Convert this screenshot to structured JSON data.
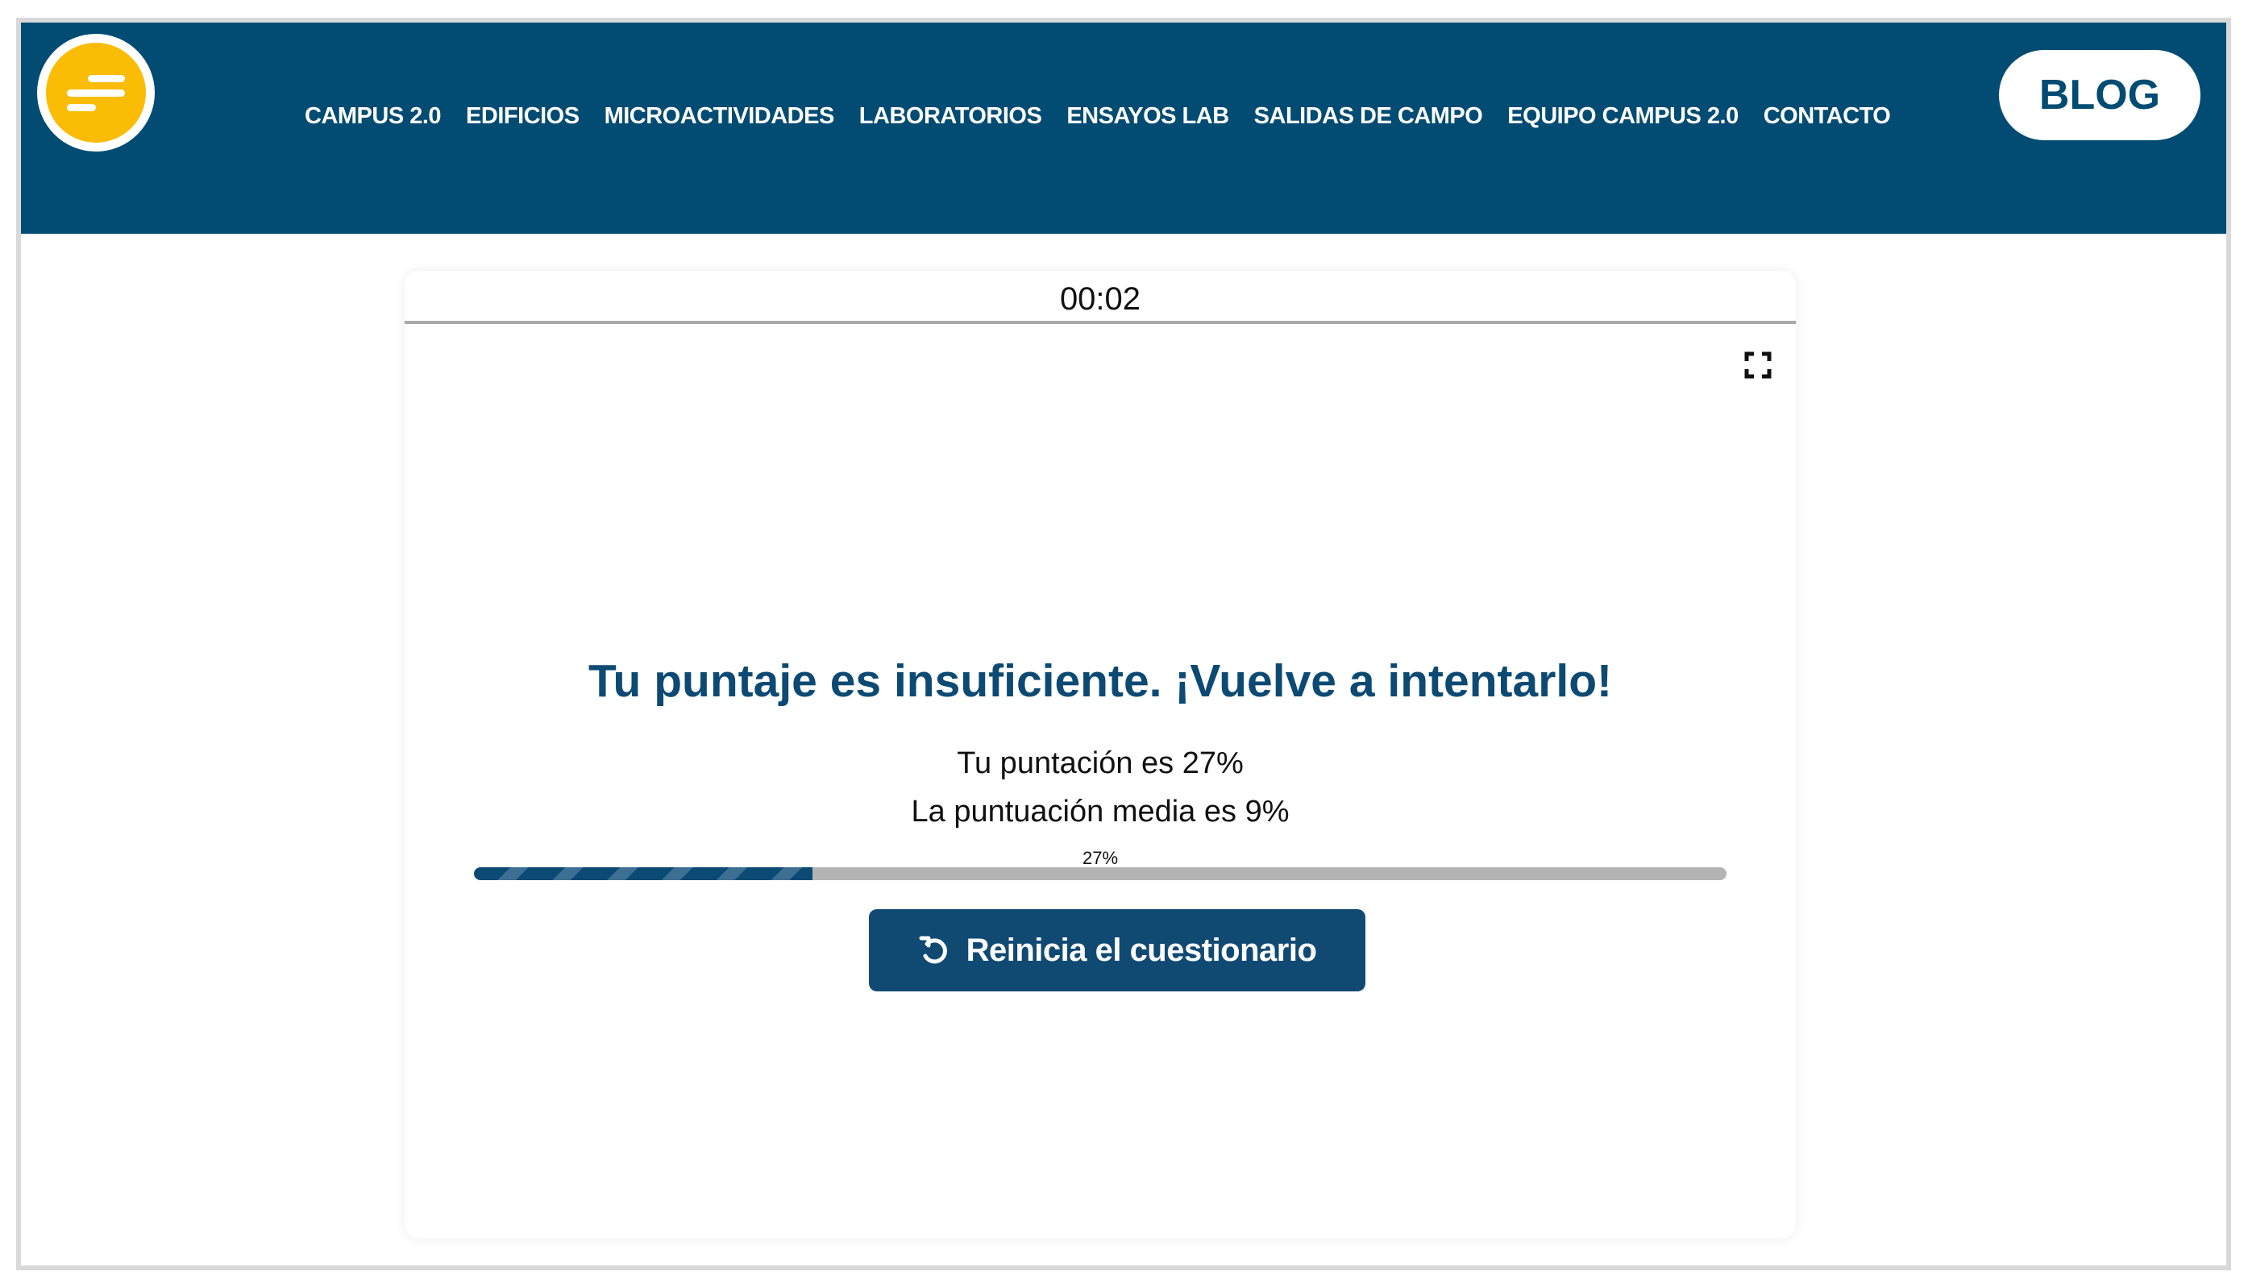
{
  "header": {
    "logo_color": "#fbbc05",
    "background_color": "#024b72",
    "nav": [
      {
        "label": "CAMPUS 2.0"
      },
      {
        "label": "EDIFICIOS"
      },
      {
        "label": "MICROACTIVIDADES"
      },
      {
        "label": "LABORATORIOS"
      },
      {
        "label": "ENSAYOS LAB"
      },
      {
        "label": "SALIDAS DE CAMPO"
      },
      {
        "label": "EQUIPO CAMPUS 2.0"
      },
      {
        "label": "CONTACTO"
      }
    ],
    "blog_label": "BLOG"
  },
  "quiz": {
    "timer": "00:02",
    "fullscreen_icon": "fullscreen-icon",
    "result_title": "Tu puntaje es insuficiente. ¡Vuelve a intentarlo!",
    "score_text": "Tu puntación es 27%",
    "average_text": "La puntuación media es 9%",
    "progress": {
      "label": "27%",
      "value_percent": 27
    },
    "restart_label": "Reinicia el cuestionario",
    "restart_icon": "restart-icon",
    "accent_color": "#104a73"
  }
}
